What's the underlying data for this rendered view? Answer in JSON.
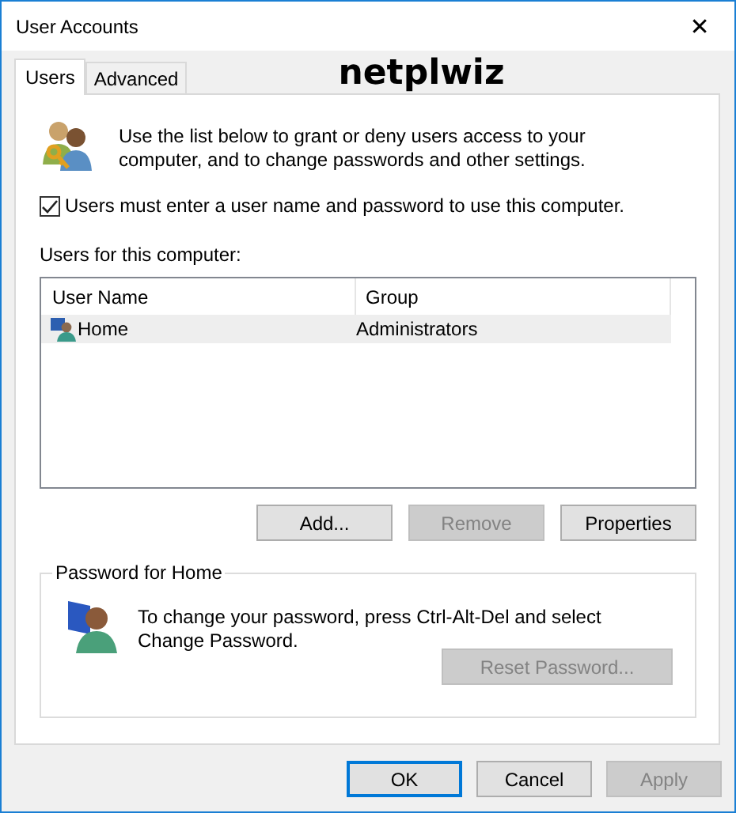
{
  "window": {
    "title": "User Accounts",
    "close": "✕"
  },
  "tabs": [
    {
      "label": "Users",
      "selected": true
    },
    {
      "label": "Advanced",
      "selected": false
    }
  ],
  "overlay_caption": "netplwiz",
  "intro": "Use the list below to grant or deny users access to your computer, and to change passwords and other settings.",
  "require_password": {
    "label": "Users must enter a user name and password to use this computer.",
    "checked": true
  },
  "users_label": "Users for this computer:",
  "table": {
    "columns": [
      "User Name",
      "Group"
    ],
    "rows": [
      {
        "name": "Home",
        "group": "Administrators",
        "selected": true
      }
    ]
  },
  "list_buttons": [
    {
      "label": "Add...",
      "disabled": false
    },
    {
      "label": "Remove",
      "disabled": true
    },
    {
      "label": "Properties",
      "disabled": false
    }
  ],
  "password_group": {
    "title": "Password for Home",
    "text": "To change your password, press Ctrl-Alt-Del and select Change Password.",
    "button": {
      "label": "Reset Password...",
      "disabled": true
    }
  },
  "dialog_buttons": [
    {
      "label": "OK",
      "default": true,
      "disabled": false
    },
    {
      "label": "Cancel",
      "default": false,
      "disabled": false
    },
    {
      "label": "Apply",
      "default": false,
      "disabled": true
    }
  ]
}
